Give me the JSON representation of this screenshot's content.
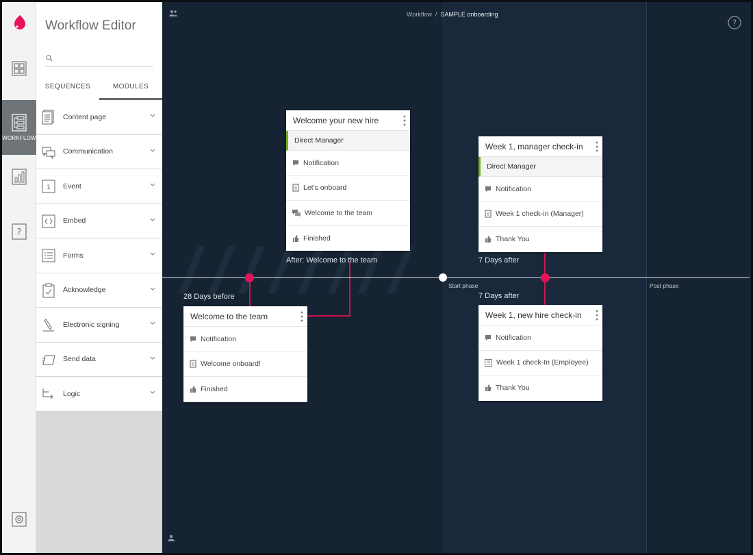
{
  "rail": {
    "items": [
      {
        "icon": "dashboard-icon",
        "label": ""
      },
      {
        "icon": "workflow-icon",
        "label": "WORKFLOW",
        "active": true
      },
      {
        "icon": "analytics-icon",
        "label": ""
      },
      {
        "icon": "help-icon",
        "label": ""
      },
      {
        "icon": "settings-icon",
        "label": ""
      }
    ]
  },
  "panel": {
    "title": "Workflow Editor",
    "search_placeholder": "",
    "tabs": [
      {
        "label": "SEQUENCES",
        "active": false
      },
      {
        "label": "MODULES",
        "active": true
      }
    ],
    "modules": [
      {
        "label": "Content page",
        "icon": "content-page-icon"
      },
      {
        "label": "Communication",
        "icon": "communication-icon"
      },
      {
        "label": "Event",
        "icon": "event-icon"
      },
      {
        "label": "Embed",
        "icon": "embed-icon"
      },
      {
        "label": "Forms",
        "icon": "forms-icon"
      },
      {
        "label": "Acknowledge",
        "icon": "acknowledge-icon"
      },
      {
        "label": "Electronic signing",
        "icon": "electronic-signing-icon"
      },
      {
        "label": "Send data",
        "icon": "send-data-icon"
      },
      {
        "label": "Logic",
        "icon": "logic-icon"
      }
    ]
  },
  "canvas": {
    "breadcrumb": {
      "parent": "Workflow",
      "separator": "/",
      "current": "SAMPLE onboarding"
    },
    "phases": {
      "start": "Start phase",
      "post": "Post phase"
    },
    "timeline_labels": {
      "before": "28 Days before",
      "after_welcome": "After: Welcome to the team",
      "seven_days_top": "7 Days after",
      "seven_days_bottom": "7 Days after"
    },
    "cards": {
      "welcome_hire": {
        "title": "Welcome your new hire",
        "role": "Direct Manager",
        "rows": [
          {
            "icon": "notification-icon",
            "label": "Notification"
          },
          {
            "icon": "content-page-icon",
            "label": "Let's onboard"
          },
          {
            "icon": "communication-icon",
            "label": "Welcome to the team"
          },
          {
            "icon": "thumbs-up-icon",
            "label": "Finished"
          }
        ]
      },
      "welcome_team": {
        "title": "Welcome to the team",
        "rows": [
          {
            "icon": "notification-icon",
            "label": "Notification"
          },
          {
            "icon": "content-page-icon",
            "label": "Welcome onboard!"
          },
          {
            "icon": "thumbs-up-icon",
            "label": "Finished"
          }
        ]
      },
      "manager_checkin": {
        "title": "Week 1, manager check-in",
        "role": "Direct Manager",
        "rows": [
          {
            "icon": "notification-icon",
            "label": "Notification"
          },
          {
            "icon": "content-page-icon",
            "label": "Week 1 check-in (Manager)"
          },
          {
            "icon": "thumbs-up-icon",
            "label": "Thank You"
          }
        ]
      },
      "hire_checkin": {
        "title": "Week 1, new hire check-in",
        "rows": [
          {
            "icon": "notification-icon",
            "label": "Notification"
          },
          {
            "icon": "form-icon",
            "label": "Week 1 check-In (Employee)"
          },
          {
            "icon": "thumbs-up-icon",
            "label": "Thank You"
          }
        ]
      }
    }
  },
  "colors": {
    "accent": "#e8125a",
    "role_bar": "#74b21c",
    "canvas_bg": "#152332",
    "rail_active": "#6f7479"
  }
}
